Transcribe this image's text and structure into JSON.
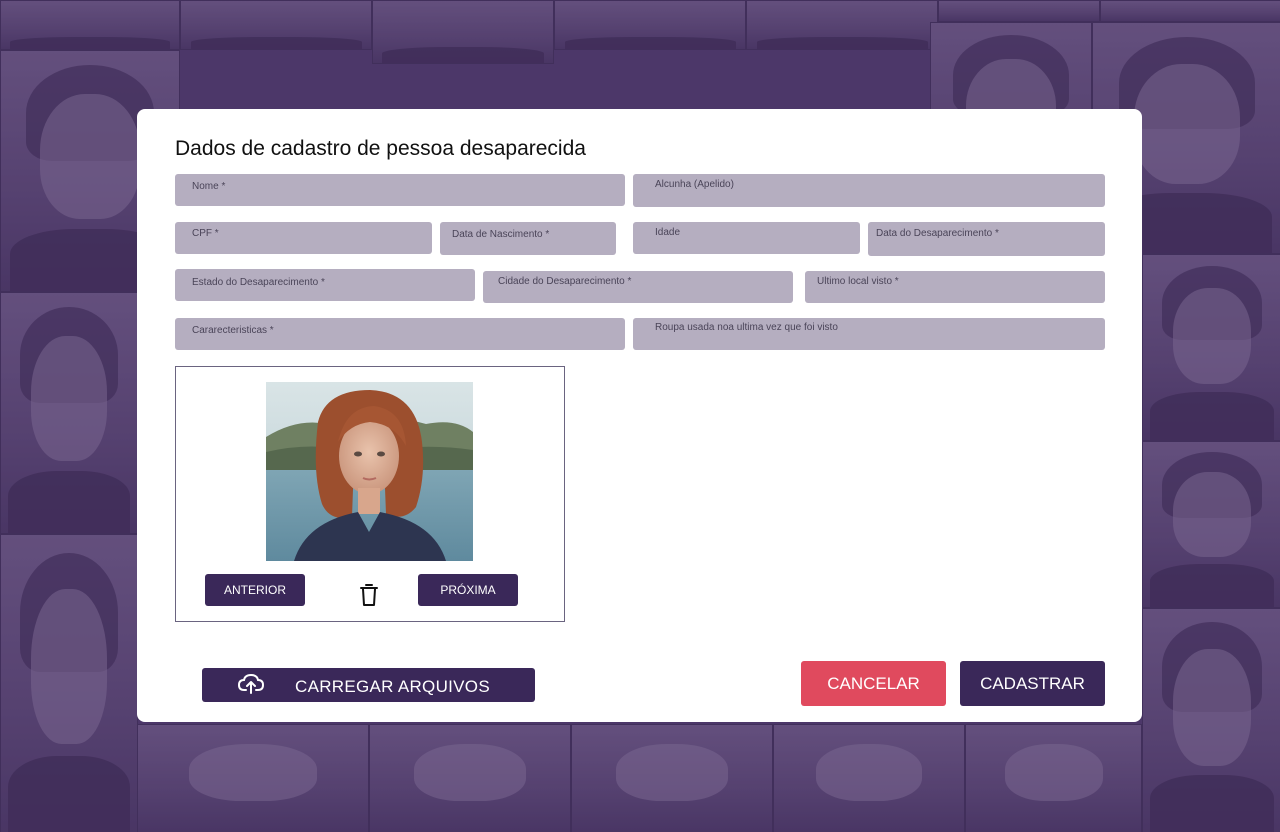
{
  "form": {
    "title": "Dados de cadastro de pessoa desaparecida",
    "fields": {
      "nome": "Nome *",
      "alcunha": "Alcunha (Apelido)",
      "cpf": "CPF *",
      "data_nascimento": "Data de Nascimento *",
      "idade": "Idade",
      "data_desaparecimento": "Data do Desaparecimento *",
      "estado_desaparecimento": "Estado do Desaparecimento *",
      "cidade_desaparecimento": "Cidade do Desaparecimento *",
      "ultimo_local": "Ultimo local visto *",
      "caracteristicas": "Cararecteristicas *",
      "roupa": "Roupa usada noa ultima vez que foi visto"
    }
  },
  "gallery": {
    "prev_label": "ANTERIOR",
    "next_label": "PRÓXIMA",
    "icons": [
      "trash-icon"
    ]
  },
  "actions": {
    "upload_label": "CARREGAR ARQUIVOS",
    "upload_icon": "cloud-upload-icon",
    "cancel_label": "CANCELAR",
    "submit_label": "CADASTRAR"
  },
  "colors": {
    "primary": "#3a2859",
    "danger": "#e04a5e",
    "field_bg": "#b5aec0",
    "background": "#4e3a6b"
  }
}
